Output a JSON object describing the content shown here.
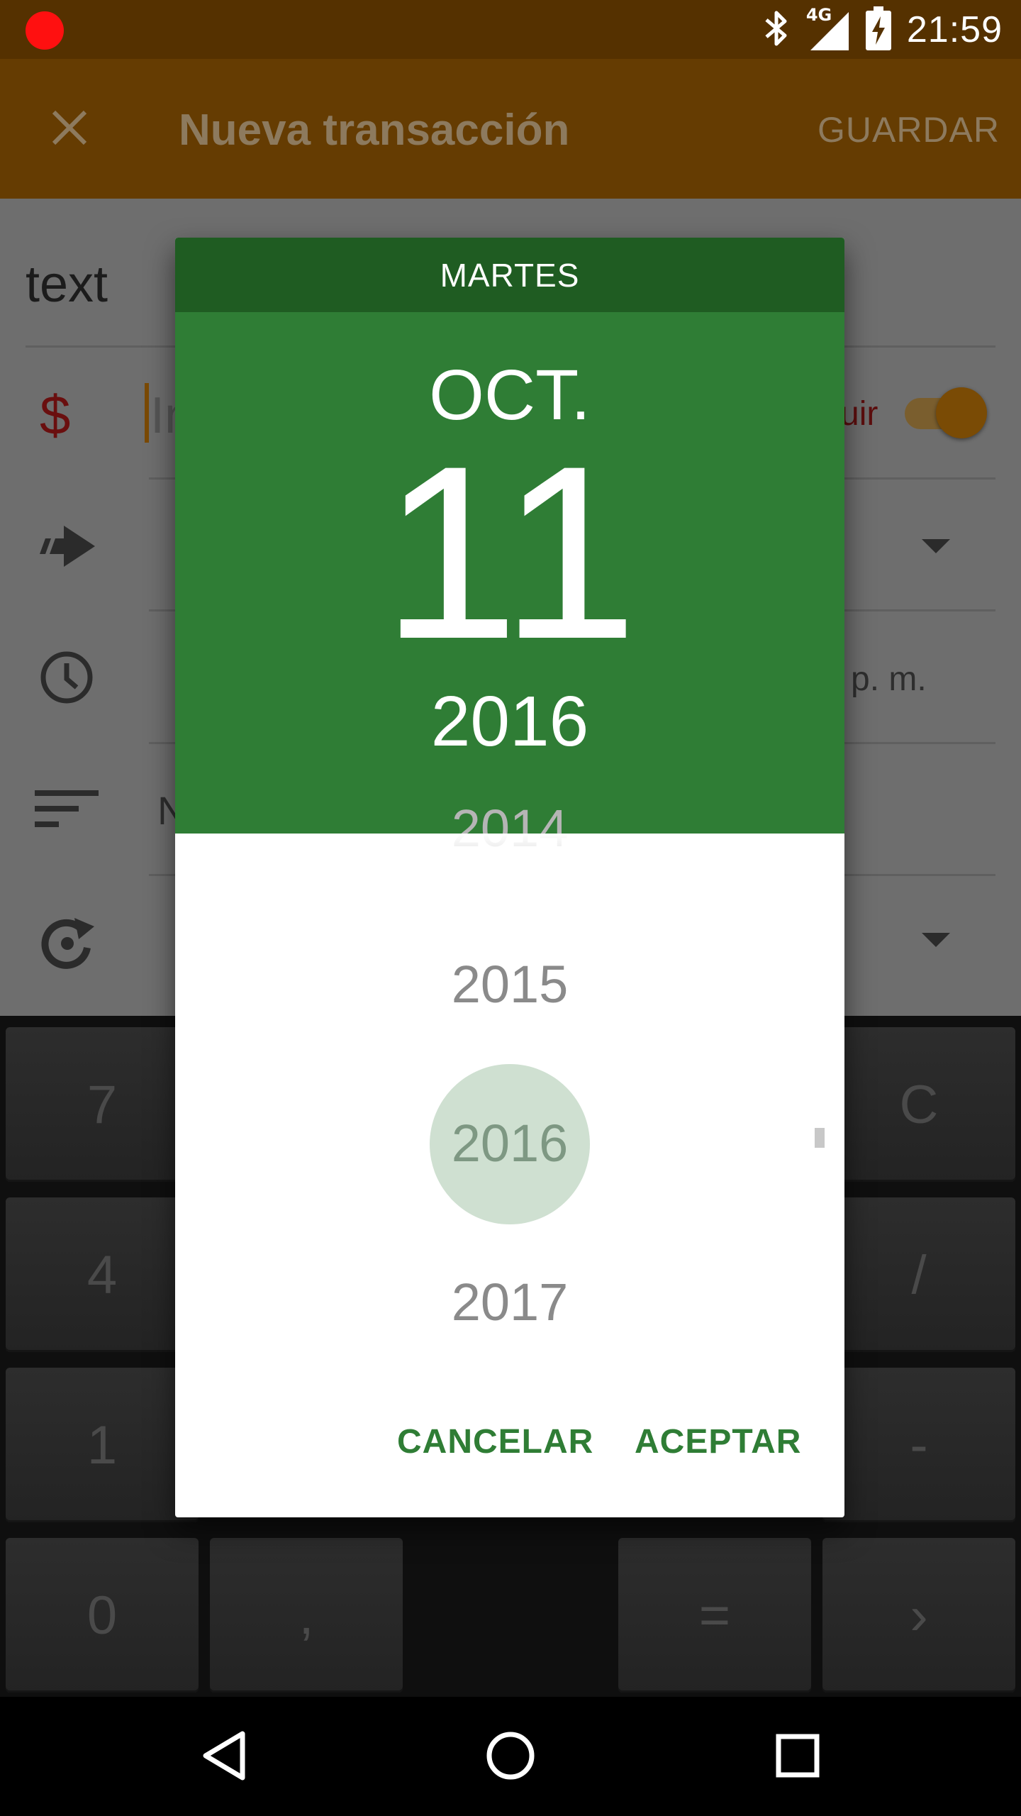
{
  "status_bar": {
    "time": "21:59",
    "network": "4G"
  },
  "app_bar": {
    "title": "Nueva transacción",
    "save_label": "GUARDAR"
  },
  "form": {
    "description_value": "text",
    "currency_symbol": "$",
    "amount_hint_partial": "In",
    "toggle_label_partial": "uir",
    "time_suffix_partial": "p. m.",
    "notes_partial": "N"
  },
  "keypad": {
    "keys": [
      "7",
      "C",
      "4",
      "/",
      "1",
      "-",
      "0",
      ",",
      "=",
      "›"
    ]
  },
  "date_picker": {
    "day_name": "MARTES",
    "month": "OCT.",
    "day": "11",
    "year": "2016",
    "years": [
      "2014",
      "2015",
      "2016",
      "2017"
    ],
    "selected_year": "2016",
    "cancel_label": "CANCELAR",
    "accept_label": "ACEPTAR",
    "accent_color": "#2f7d35",
    "header_dark_color": "#1f5c22"
  }
}
